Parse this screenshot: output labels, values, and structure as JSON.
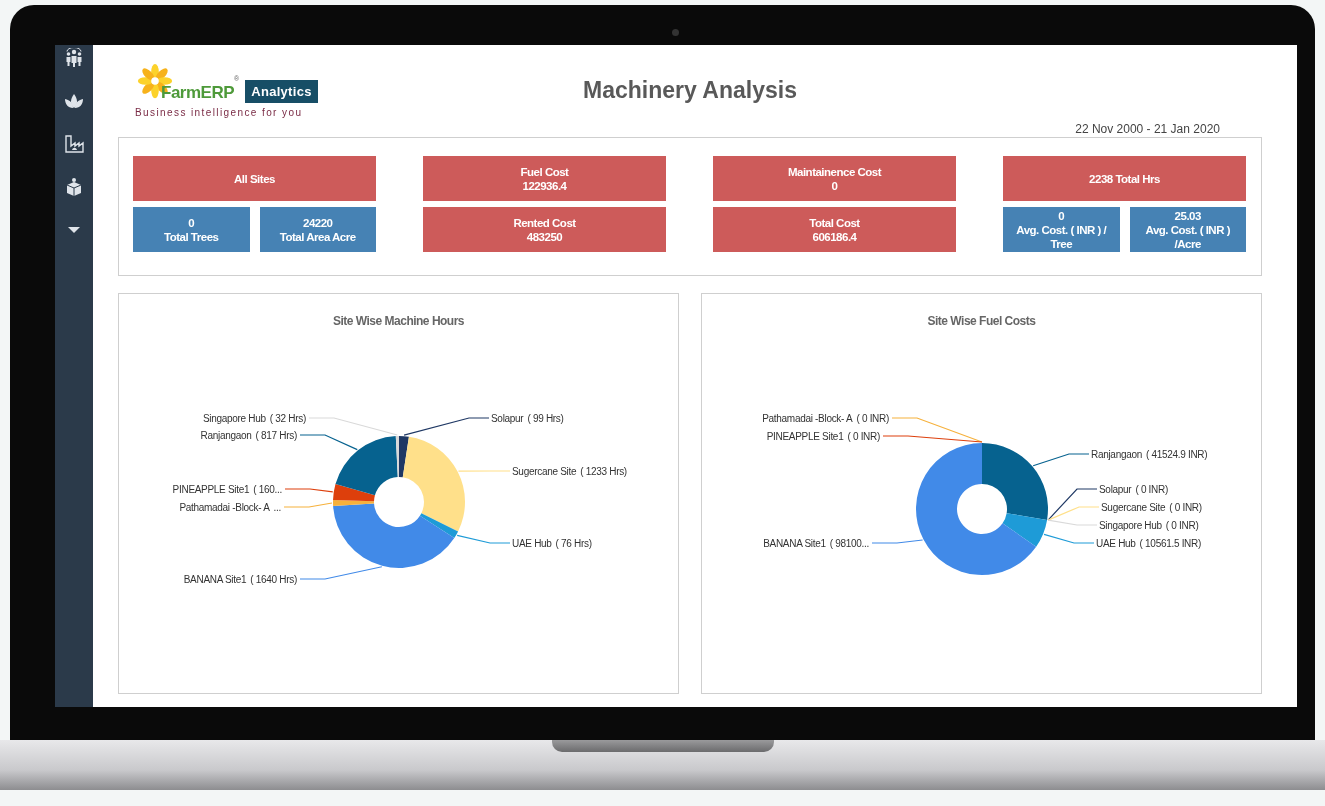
{
  "logo": {
    "brand": "FarmERP",
    "registered": "®",
    "product": "Analytics",
    "tagline": "Business intelligence for you"
  },
  "title": "Machinery Analysis",
  "date_range": "22 Nov 2000 - 21 Jan 2020",
  "kpi_groups": [
    {
      "top": {
        "lines": [
          "All Sites"
        ],
        "color": "#cd5b5a"
      },
      "bottom": [
        {
          "lines": [
            "0",
            "Total Trees"
          ],
          "color": "#4682b4"
        },
        {
          "lines": [
            "24220",
            "Total Area Acre"
          ],
          "color": "#4682b4"
        }
      ]
    },
    {
      "top": {
        "lines": [
          "Fuel Cost",
          "122936.4"
        ],
        "color": "#cd5b5a"
      },
      "bottom": [
        {
          "lines": [
            "Rented Cost",
            "483250"
          ],
          "color": "#cd5b5a"
        }
      ]
    },
    {
      "top": {
        "lines": [
          "Maintainence Cost",
          "0"
        ],
        "color": "#cd5b5a"
      },
      "bottom": [
        {
          "lines": [
            "Total Cost",
            "606186.4"
          ],
          "color": "#cd5b5a"
        }
      ]
    },
    {
      "top": {
        "lines": [
          "2238 Total Hrs"
        ],
        "color": "#cd5b5a"
      },
      "bottom": [
        {
          "lines": [
            "0",
            "Avg. Cost. ( INR ) /",
            "Tree"
          ],
          "color": "#4682b4"
        },
        {
          "lines": [
            "25.03",
            "Avg. Cost. ( INR )",
            "/Acre"
          ],
          "color": "#4682b4"
        }
      ]
    }
  ],
  "charts": [
    {
      "chart_data": {
        "type": "donut",
        "title": "Site Wise Machine Hours",
        "categories": [
          "Solapur",
          "Sugercane Site",
          "UAE Hub",
          "BANANA Site1",
          "Pathamadai -Block- A",
          "PINEAPPLE Site1",
          "Ranjangaon",
          "Singapore Hub"
        ],
        "values": [
          99,
          1233,
          76,
          1640,
          60,
          160,
          817,
          32
        ],
        "colors": [
          "#1f3864",
          "#ffe08a",
          "#1e9bd7",
          "#418ae8",
          "#f6b13c",
          "#dd3f0c",
          "#06628f",
          "#d9d9d9"
        ],
        "data_labels": true,
        "value_labels": [
          "( 99 Hrs)",
          "( 1233 Hrs)",
          "( 76 Hrs)",
          "( 1640 Hrs)",
          "...",
          "( 160...",
          "( 817 Hrs)",
          "( 32 Hrs)"
        ]
      }
    },
    {
      "chart_data": {
        "type": "donut",
        "title": "Site Wise Fuel Costs",
        "categories": [
          "Ranjangaon",
          "Solapur",
          "Sugercane Site",
          "Singapore Hub",
          "UAE Hub",
          "BANANA Site1",
          "Pathamadai -Block- A",
          "PINEAPPLE Site1"
        ],
        "values": [
          41524.9,
          0,
          0,
          0,
          10561.5,
          98100,
          0,
          0
        ],
        "colors": [
          "#06628f",
          "#1f3864",
          "#ffe08a",
          "#d9d9d9",
          "#1e9bd7",
          "#418ae8",
          "#f6b13c",
          "#dd3f0c"
        ],
        "data_labels": true,
        "value_labels": [
          "( 41524.9 INR)",
          "( 0 INR)",
          "( 0 INR)",
          "( 0 INR)",
          "( 10561.5 INR)",
          "( 98100...",
          "( 0 INR)",
          "( 0 INR)"
        ]
      }
    }
  ]
}
